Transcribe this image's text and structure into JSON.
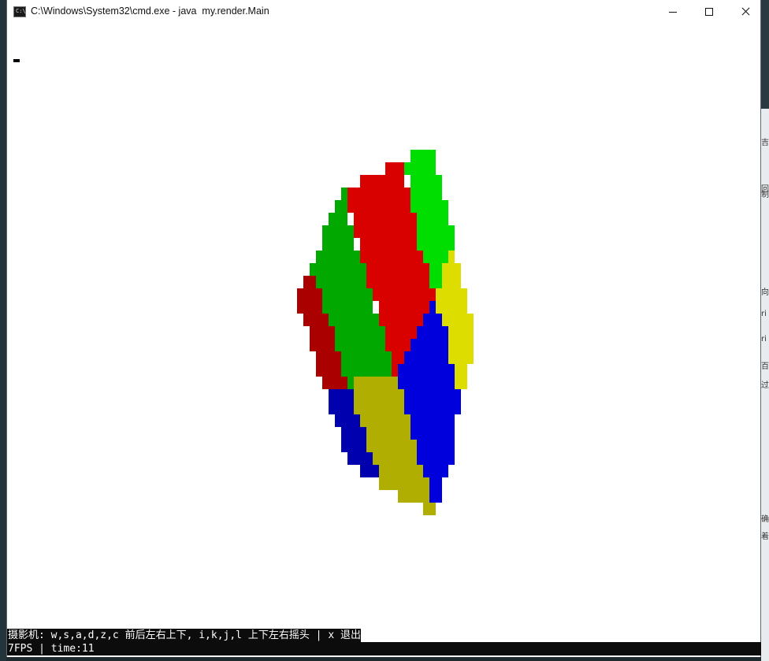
{
  "window": {
    "title": "C:\\Windows\\System32\\cmd.exe - java  my.render.Main",
    "icon": "cmd-icon",
    "icon_text": "C:\\"
  },
  "controls": {
    "minimize": "minimize-icon",
    "maximize": "maximize-icon",
    "close": "close-icon"
  },
  "console": {
    "controls_hint": "摄影机: w,s,a,d,z,c 前后左右上下, i,k,j,l 上下左右摇头 | x 退出",
    "status": "7FPS | time:11"
  },
  "background_right_glyphs": [
    "吉",
    "回",
    "制",
    "向",
    "ri",
    "ri",
    "百",
    "过",
    "确",
    "着"
  ],
  "colors": {
    "red": "#d90000",
    "dark_red": "#ab0000",
    "green": "#00a800",
    "bright_green": "#00dd00",
    "yellow": "#dddd00",
    "olive": "#b0ae00",
    "blue": "#0000dd",
    "dark_blue": "#0000ae"
  }
}
